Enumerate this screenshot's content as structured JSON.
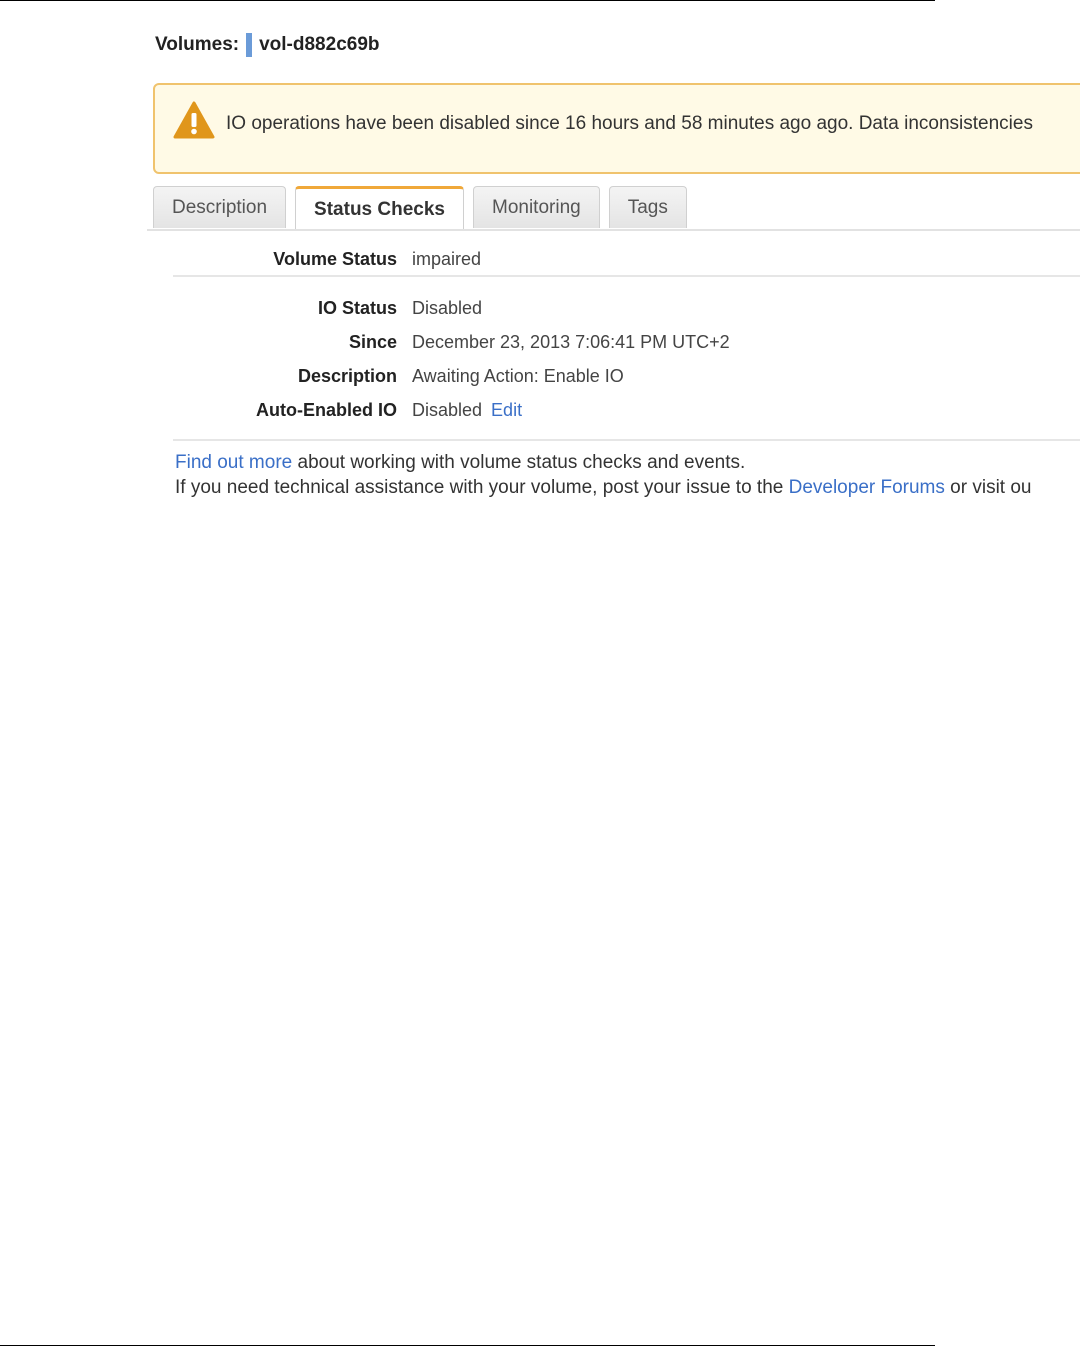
{
  "header": {
    "label": "Volumes:",
    "volume_id": "vol-d882c69b"
  },
  "alert": {
    "icon": "warning-icon",
    "message": "IO operations have been disabled since 16 hours and 58 minutes ago ago. Data inconsistencies"
  },
  "tabs": [
    {
      "label": "Description",
      "active": false
    },
    {
      "label": "Status Checks",
      "active": true
    },
    {
      "label": "Monitoring",
      "active": false
    },
    {
      "label": "Tags",
      "active": false
    }
  ],
  "details": {
    "volume_status": {
      "label": "Volume Status",
      "value": "impaired"
    },
    "io_status": {
      "label": "IO Status",
      "value": "Disabled"
    },
    "since": {
      "label": "Since",
      "value": "December 23, 2013 7:06:41 PM UTC+2"
    },
    "description": {
      "label": "Description",
      "value": "Awaiting Action: Enable IO"
    },
    "auto_enabled_io": {
      "label": "Auto-Enabled IO",
      "value": "Disabled",
      "action": "Edit"
    }
  },
  "footer": {
    "line1_link": "Find out more",
    "line1_text": "about working with volume status checks and events.",
    "line2_text": "If you need technical assistance with your volume, post your issue to the",
    "line2_link": "Developer Forums",
    "line2_tail": "or visit ou"
  },
  "colors": {
    "link": "#3a6fc7",
    "alert_border": "#f0c36d",
    "alert_background": "#fffae6",
    "warning_icon": "#e0961b",
    "active_tab_accent": "#f0a839",
    "volume_marker": "#6b9bd8"
  }
}
